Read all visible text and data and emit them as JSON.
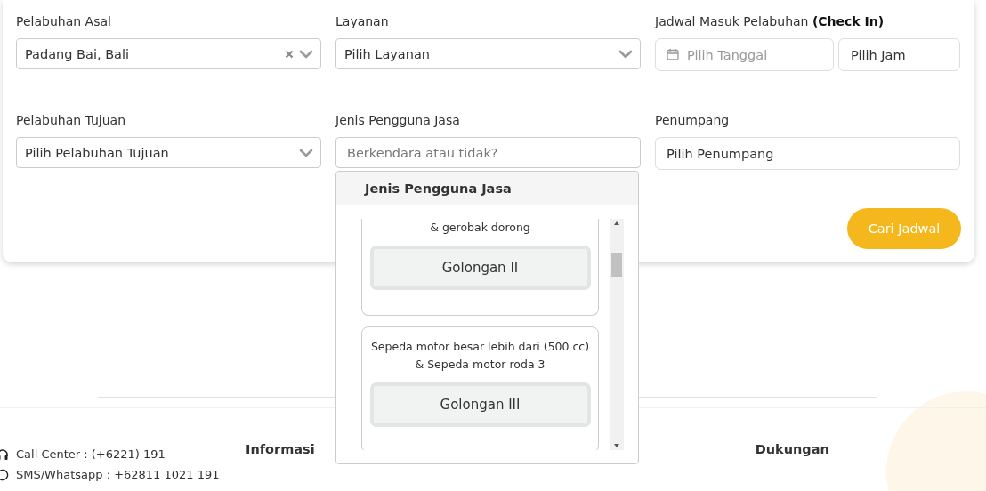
{
  "search_form": {
    "fields": [
      {
        "kind": "select",
        "label": "Pelabuhan Asal",
        "value": "Padang Bai, Bali",
        "clearable": true
      },
      {
        "kind": "select",
        "label": "Layanan",
        "value": "Pilih Layanan",
        "clearable": false
      },
      {
        "kind": "datetime",
        "label": "Jadwal Masuk Pelabuhan **(Check In)**",
        "date_placeholder": "Pilih Tanggal",
        "time_value": "Pilih Jam"
      },
      {
        "kind": "select",
        "label": "Pelabuhan Tujuan",
        "value": "Pilih Pelabuhan Tujuan",
        "clearable": false
      },
      {
        "kind": "input",
        "label": "Jenis Pengguna Jasa",
        "placeholder": "Berkendara atau tidak?"
      },
      {
        "kind": "text",
        "label": "Penumpang",
        "value": "Pilih Penumpang"
      }
    ],
    "submit": "Cari Jadwal"
  },
  "user_type_dropdown": {
    "header": "Jenis Pengguna Jasa",
    "options": [
      {
        "description_lines": [
          "& gerobak dorong"
        ],
        "button": "Golongan II"
      },
      {
        "description_lines": [
          "Sepeda motor besar lebih dari (500 cc)",
          "& Sepeda motor roda 3"
        ],
        "button": "Golongan III"
      }
    ]
  },
  "footer": {
    "contacts": [
      {
        "kind": "headset",
        "text": "Call Center : (+6221) 191"
      },
      {
        "kind": "chat",
        "text": "SMS/Whatsapp : +62811 1021 191"
      }
    ],
    "headings": [
      "Informasi",
      "Dukungan"
    ]
  }
}
